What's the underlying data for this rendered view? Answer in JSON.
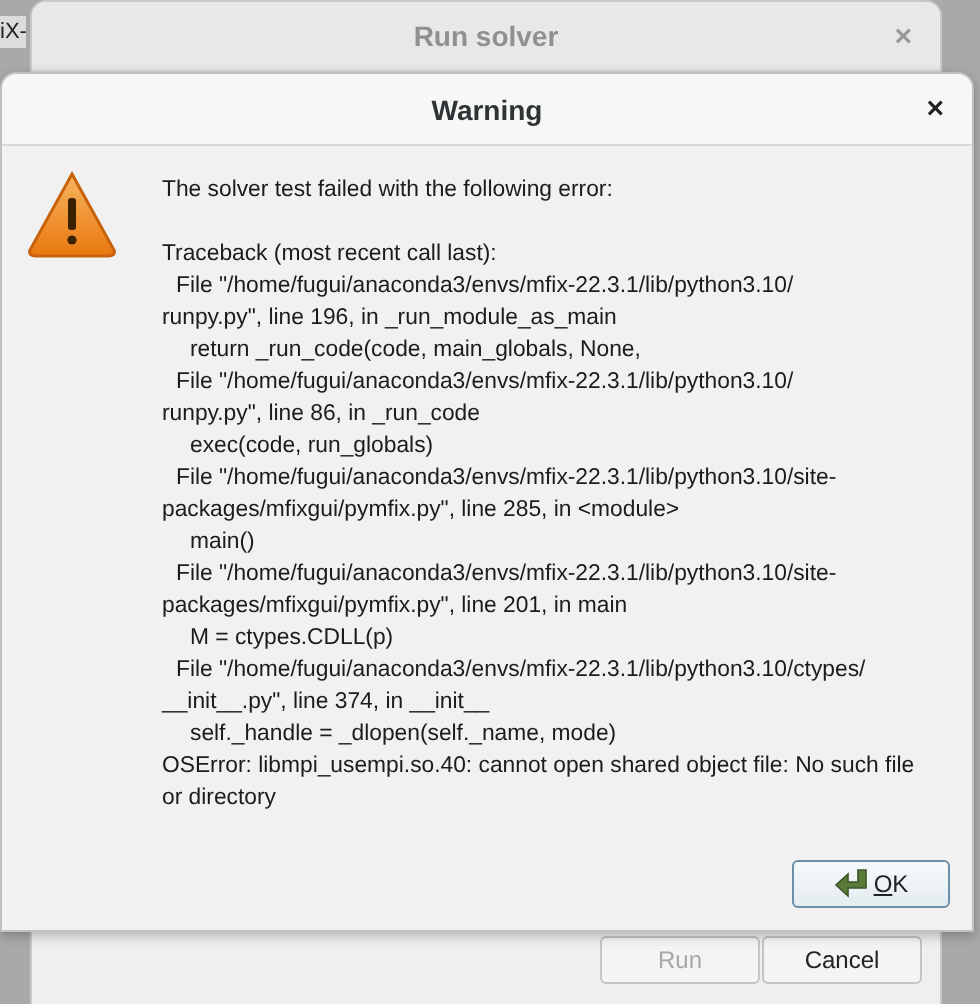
{
  "background_window": {
    "title_fragment": "iX-"
  },
  "run_solver_dialog": {
    "title": "Run solver",
    "close": "×",
    "buttons": [
      {
        "label": "Run",
        "disabled": true
      },
      {
        "label": "Cancel",
        "disabled": false
      }
    ]
  },
  "warning_dialog": {
    "title": "Warning",
    "close": "×",
    "message": [
      {
        "kind": "plain",
        "text": "The solver test failed with the following error:"
      },
      {
        "kind": "gap"
      },
      {
        "kind": "plain",
        "text": "Traceback (most recent call last):"
      },
      {
        "kind": "frame",
        "text": "File \"/home/fugui/anaconda3/envs/mfix-22.3.1/lib/python3.10/"
      },
      {
        "kind": "plain",
        "text": "runpy.py\", line 196, in _run_module_as_main"
      },
      {
        "kind": "code",
        "text": "return _run_code(code, main_globals, None,"
      },
      {
        "kind": "frame",
        "text": "File \"/home/fugui/anaconda3/envs/mfix-22.3.1/lib/python3.10/"
      },
      {
        "kind": "plain",
        "text": "runpy.py\", line 86, in _run_code"
      },
      {
        "kind": "code",
        "text": "exec(code, run_globals)"
      },
      {
        "kind": "frame",
        "text": "File \"/home/fugui/anaconda3/envs/mfix-22.3.1/lib/python3.10/site-"
      },
      {
        "kind": "plain",
        "text": "packages/mfixgui/pymfix.py\", line 285, in <module>"
      },
      {
        "kind": "code",
        "text": "main()"
      },
      {
        "kind": "frame",
        "text": "File \"/home/fugui/anaconda3/envs/mfix-22.3.1/lib/python3.10/site-"
      },
      {
        "kind": "plain",
        "text": "packages/mfixgui/pymfix.py\", line 201, in main"
      },
      {
        "kind": "code",
        "text": "M = ctypes.CDLL(p)"
      },
      {
        "kind": "frame",
        "text": "File \"/home/fugui/anaconda3/envs/mfix-22.3.1/lib/python3.10/ctypes/"
      },
      {
        "kind": "plain",
        "text": "__init__.py\", line 374, in __init__"
      },
      {
        "kind": "code",
        "text": "self._handle = _dlopen(self._name, mode)"
      },
      {
        "kind": "plain",
        "text": "OSError: libmpi_usempi.so.40: cannot open shared object file: No such file"
      },
      {
        "kind": "plain",
        "text": "or directory"
      }
    ],
    "ok_button": {
      "label": "OK",
      "mnemonic_underlined": true
    }
  }
}
